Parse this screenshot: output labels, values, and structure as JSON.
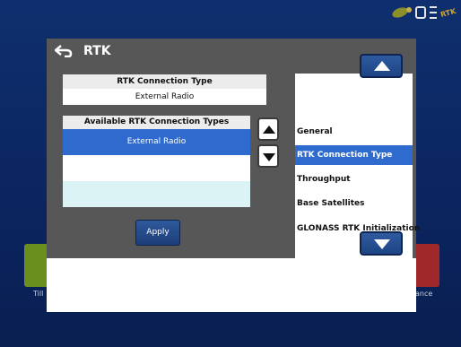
{
  "dialog": {
    "title": "RTK",
    "connection": {
      "header": "RTK Connection Type",
      "value": "External Radio"
    },
    "available": {
      "header": "Available RTK Connection Types",
      "items": [
        "External Radio",
        "",
        ""
      ],
      "selected_index": 0
    },
    "apply_label": "Apply"
  },
  "nav": {
    "items": [
      {
        "label": "General"
      },
      {
        "label": "RTK Connection Type"
      },
      {
        "label": "Throughput"
      },
      {
        "label": "Base Satellites"
      },
      {
        "label": "GLONASS RTK Initialization"
      }
    ],
    "selected_index": 1
  },
  "background": {
    "left_tile_label": "Till",
    "right_tile_label": "ance"
  },
  "status": {
    "signal_text": "RTK"
  },
  "colors": {
    "selection": "#2f6bcf",
    "dialog_bg": "#575757",
    "app_bg": "#0b2560",
    "button_blue": "#2a5496"
  },
  "icons": [
    "back-arrow-icon",
    "satellite-icon",
    "device-box-icon",
    "menu-lines-icon",
    "up-arrow-icon",
    "down-arrow-icon"
  ]
}
